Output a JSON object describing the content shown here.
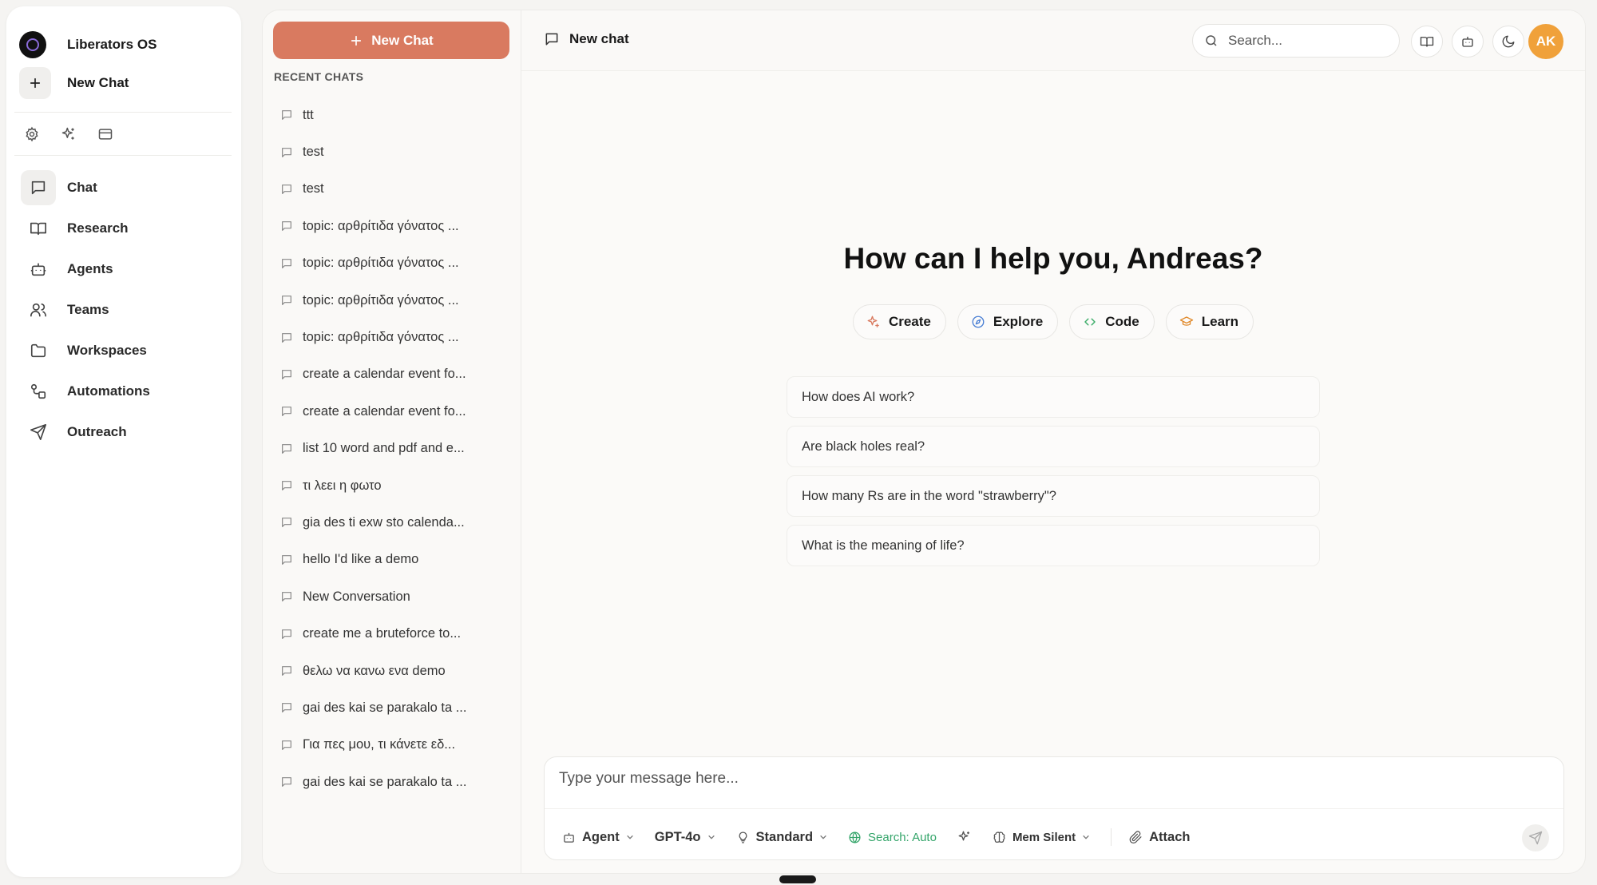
{
  "brand": {
    "name": "Liberators OS"
  },
  "sidebar": {
    "new_chat_label": "New Chat",
    "nav": [
      {
        "label": "Chat",
        "icon": "chat-icon",
        "active": true
      },
      {
        "label": "Research",
        "icon": "book-icon"
      },
      {
        "label": "Agents",
        "icon": "bot-icon"
      },
      {
        "label": "Teams",
        "icon": "users-icon"
      },
      {
        "label": "Workspaces",
        "icon": "folder-icon"
      },
      {
        "label": "Automations",
        "icon": "automation-icon"
      },
      {
        "label": "Outreach",
        "icon": "send-icon"
      }
    ]
  },
  "chatlist": {
    "new_chat_label": "New Chat",
    "recent_title": "RECENT CHATS",
    "items": [
      "ttt",
      "test",
      "test",
      "topic: αρθρίτιδα γόνατος ...",
      "topic: αρθρίτιδα γόνατος ...",
      "topic: αρθρίτιδα γόνατος ...",
      "topic: αρθρίτιδα γόνατος ...",
      "create a calendar event fo...",
      "create a calendar event fo...",
      "list 10 word and pdf and e...",
      "τι λεει η φωτο",
      "gia des ti exw sto calenda...",
      "hello I'd like a demo",
      "New Conversation",
      "create me a bruteforce to...",
      "θελω να κανω ενα demo",
      "gai des kai se parakalo ta ...",
      "Για πες μου, τι κάνετε εδ...",
      "gai des kai se parakalo ta ..."
    ]
  },
  "topbar": {
    "title": "New chat",
    "search_placeholder": "Search...",
    "avatar_initials": "AK"
  },
  "main": {
    "greeting": "How can I help you, Andreas?",
    "actions": {
      "create": "Create",
      "explore": "Explore",
      "code": "Code",
      "learn": "Learn"
    },
    "suggestions": [
      "How does AI work?",
      "Are black holes real?",
      "How many Rs are in the word \"strawberry\"?",
      "What is the meaning of life?"
    ]
  },
  "composer": {
    "placeholder": "Type your message here...",
    "agent": "Agent",
    "model": "GPT-4o",
    "mode": "Standard",
    "search": "Search: Auto",
    "memory": "Mem Silent",
    "attach": "Attach"
  },
  "colors": {
    "accent": "#d97a60",
    "avatar": "#f0a13a",
    "search_green": "#34a56a"
  }
}
